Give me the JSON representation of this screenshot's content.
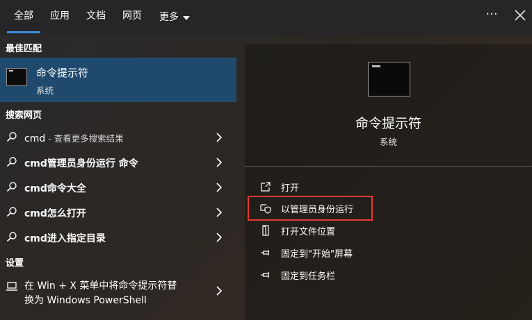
{
  "tabs": [
    {
      "label": "全部",
      "active": true
    },
    {
      "label": "应用",
      "active": false
    },
    {
      "label": "文档",
      "active": false
    },
    {
      "label": "网页",
      "active": false
    },
    {
      "label": "更多",
      "active": false
    }
  ],
  "top_actions": {
    "more_icon": "ellipsis-icon",
    "close_icon": "close-icon",
    "ellipsis": "···"
  },
  "left": {
    "best_match_title": "最佳匹配",
    "best_match": {
      "name": "命令提示符",
      "type": "系统"
    },
    "web_title": "搜索网页",
    "web_items": [
      {
        "text": "cmd",
        "hint": " - 查看更多搜索结果"
      },
      {
        "text": "cmd管理员身份运行 命令",
        "hint": ""
      },
      {
        "text": "cmd命令大全",
        "hint": ""
      },
      {
        "text": "cmd怎么打开",
        "hint": ""
      },
      {
        "text": "cmd进入指定目录",
        "hint": ""
      }
    ],
    "settings_title": "设置",
    "settings_item": {
      "line1": "在 Win + X 菜单中将命令提示符替",
      "line2": "换为 Windows PowerShell"
    }
  },
  "right": {
    "app_name": "命令提示符",
    "app_type": "系统",
    "actions": [
      {
        "label": "打开",
        "icon": "open-icon"
      },
      {
        "label": "以管理员身份运行",
        "icon": "shield-icon"
      },
      {
        "label": "打开文件位置",
        "icon": "file-location-icon"
      },
      {
        "label": "固定到\"开始\"屏幕",
        "icon": "pin-icon"
      },
      {
        "label": "固定到任务栏",
        "icon": "pin-icon"
      }
    ]
  },
  "colors": {
    "accent": "#3d8fe0",
    "selected_bg": "#1f4a6e",
    "highlight_border": "#e53935"
  }
}
